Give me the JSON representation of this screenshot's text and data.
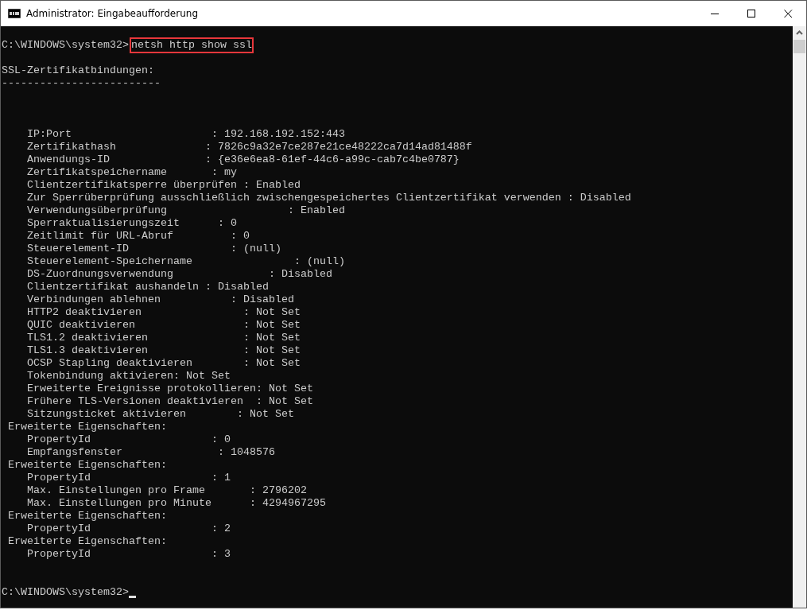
{
  "window": {
    "title": "Administrator: Eingabeaufforderung"
  },
  "console": {
    "prompt": "C:\\WINDOWS\\system32>",
    "command": {
      "text": "netsh http show ssl",
      "highlighted": true
    },
    "heading": "SSL-Zertifikatbindungen:",
    "underline": "-------------------------",
    "entries": [
      "    IP:Port                      : 192.168.192.152:443",
      "    Zertifikathash              : 7826c9a32e7ce287e21ce48222ca7d14ad81488f",
      "    Anwendungs-ID               : {e36e6ea8-61ef-44c6-a99c-cab7c4be0787}",
      "    Zertifikatspeichername       : my",
      "    Clientzertifikatsperre überprüfen : Enabled",
      "    Zur Sperrüberprüfung ausschließlich zwischengespeichertes Clientzertifikat verwenden : Disabled",
      "    Verwendungsüberprüfung                   : Enabled",
      "    Sperraktualisierungszeit      : 0",
      "    Zeitlimit für URL-Abruf         : 0",
      "    Steuerelement-ID                : (null)",
      "    Steuerelement-Speichername                : (null)",
      "    DS-Zuordnungsverwendung               : Disabled",
      "    Clientzertifikat aushandeln : Disabled",
      "    Verbindungen ablehnen           : Disabled",
      "    HTTP2 deaktivieren                : Not Set",
      "    QUIC deaktivieren                 : Not Set",
      "    TLS1.2 deaktivieren               : Not Set",
      "    TLS1.3 deaktivieren               : Not Set",
      "    OCSP Stapling deaktivieren        : Not Set",
      "    Tokenbindung aktivieren: Not Set",
      "    Erweiterte Ereignisse protokollieren: Not Set",
      "    Frühere TLS-Versionen deaktivieren  : Not Set",
      "    Sitzungsticket aktivieren        : Not Set",
      " Erweiterte Eigenschaften:",
      "    PropertyId                   : 0",
      "    Empfangsfenster               : 1048576",
      " Erweiterte Eigenschaften:",
      "    PropertyId                   : 1",
      "    Max. Einstellungen pro Frame       : 2796202",
      "    Max. Einstellungen pro Minute      : 4294967295",
      " Erweiterte Eigenschaften:",
      "    PropertyId                   : 2",
      " Erweiterte Eigenschaften:",
      "    PropertyId                   : 3"
    ],
    "final_prompt": "C:\\WINDOWS\\system32>"
  }
}
